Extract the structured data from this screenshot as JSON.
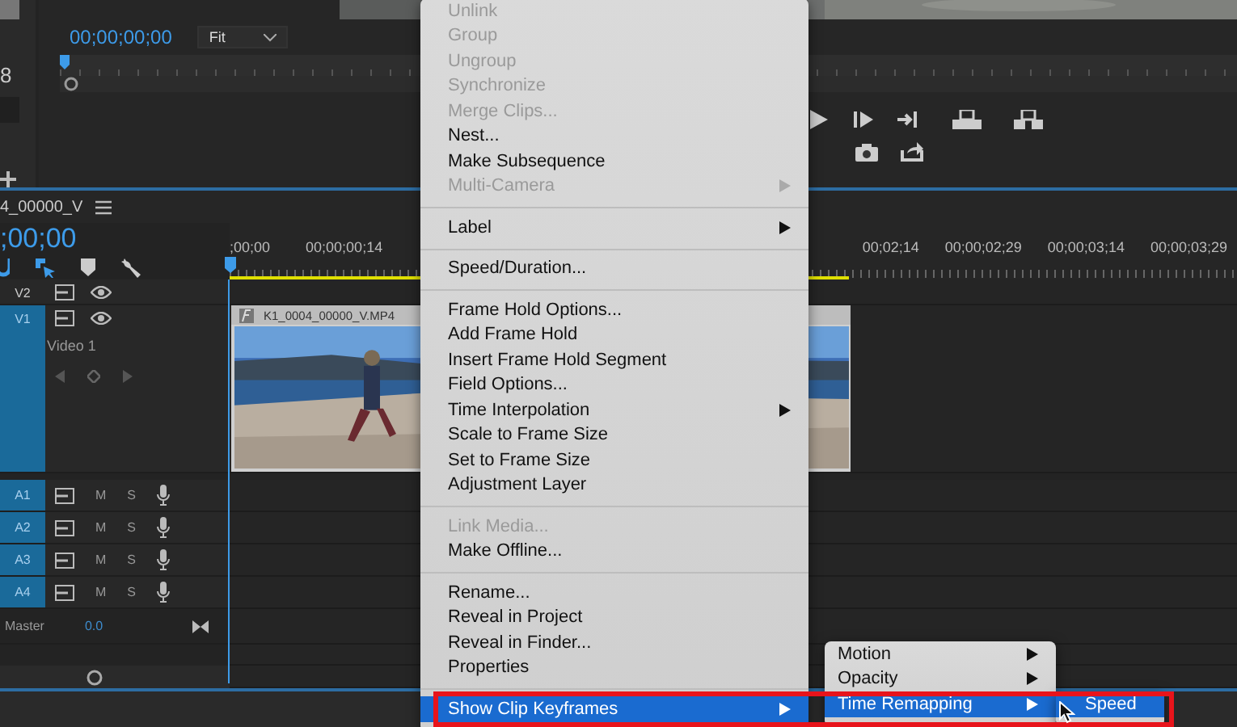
{
  "program_monitor": {
    "side_text": "8",
    "timecode": "00;00;00;00",
    "zoom": "Fit"
  },
  "sequence": {
    "tab_title": "4_00000_V",
    "timecode": ";00;00"
  },
  "ruler_left": [
    ";00;00",
    "00;00;00;14"
  ],
  "ruler_right": [
    "00;02;14",
    "00;00;02;29",
    "00;00;03;14",
    "00;00;03;29"
  ],
  "video_tracks": [
    {
      "name": "V2",
      "targeted": false
    },
    {
      "name": "V1",
      "label": "Video 1",
      "targeted": true
    }
  ],
  "audio_tracks": [
    {
      "name": "A1",
      "targeted": true,
      "mute": "M",
      "solo": "S"
    },
    {
      "name": "A2",
      "targeted": true,
      "mute": "M",
      "solo": "S"
    },
    {
      "name": "A3",
      "targeted": true,
      "mute": "M",
      "solo": "S"
    },
    {
      "name": "A4",
      "targeted": true,
      "mute": "M",
      "solo": "S"
    }
  ],
  "master": {
    "label": "Master",
    "value": "0.0"
  },
  "clip": {
    "name": "K1_0004_00000_V.MP4"
  },
  "context_menu": {
    "items": [
      {
        "kind": "item",
        "label": "Unlink",
        "disabled": true,
        "submenu": false,
        "selected": false
      },
      {
        "kind": "item",
        "label": "Group",
        "disabled": true,
        "submenu": false,
        "selected": false
      },
      {
        "kind": "item",
        "label": "Ungroup",
        "disabled": true,
        "submenu": false,
        "selected": false
      },
      {
        "kind": "item",
        "label": "Synchronize",
        "disabled": true,
        "submenu": false,
        "selected": false
      },
      {
        "kind": "item",
        "label": "Merge Clips...",
        "disabled": true,
        "submenu": false,
        "selected": false
      },
      {
        "kind": "item",
        "label": "Nest...",
        "disabled": false,
        "submenu": false,
        "selected": false
      },
      {
        "kind": "item",
        "label": "Make Subsequence",
        "disabled": false,
        "submenu": false,
        "selected": false
      },
      {
        "kind": "item",
        "label": "Multi-Camera",
        "disabled": true,
        "submenu": true,
        "selected": false
      },
      {
        "kind": "separator"
      },
      {
        "kind": "item",
        "label": "Label",
        "disabled": false,
        "submenu": true,
        "selected": false
      },
      {
        "kind": "separator"
      },
      {
        "kind": "item",
        "label": "Speed/Duration...",
        "disabled": false,
        "submenu": false,
        "selected": false
      },
      {
        "kind": "separator"
      },
      {
        "kind": "item",
        "label": "Frame Hold Options...",
        "disabled": false,
        "submenu": false,
        "selected": false
      },
      {
        "kind": "item",
        "label": "Add Frame Hold",
        "disabled": false,
        "submenu": false,
        "selected": false
      },
      {
        "kind": "item",
        "label": "Insert Frame Hold Segment",
        "disabled": false,
        "submenu": false,
        "selected": false
      },
      {
        "kind": "item",
        "label": "Field Options...",
        "disabled": false,
        "submenu": false,
        "selected": false
      },
      {
        "kind": "item",
        "label": "Time Interpolation",
        "disabled": false,
        "submenu": true,
        "selected": false
      },
      {
        "kind": "item",
        "label": "Scale to Frame Size",
        "disabled": false,
        "submenu": false,
        "selected": false
      },
      {
        "kind": "item",
        "label": "Set to Frame Size",
        "disabled": false,
        "submenu": false,
        "selected": false
      },
      {
        "kind": "item",
        "label": "Adjustment Layer",
        "disabled": false,
        "submenu": false,
        "selected": false
      },
      {
        "kind": "separator"
      },
      {
        "kind": "item",
        "label": "Link Media...",
        "disabled": true,
        "submenu": false,
        "selected": false
      },
      {
        "kind": "item",
        "label": "Make Offline...",
        "disabled": false,
        "submenu": false,
        "selected": false
      },
      {
        "kind": "separator"
      },
      {
        "kind": "item",
        "label": "Rename...",
        "disabled": false,
        "submenu": false,
        "selected": false
      },
      {
        "kind": "item",
        "label": "Reveal in Project",
        "disabled": false,
        "submenu": false,
        "selected": false
      },
      {
        "kind": "item",
        "label": "Reveal in Finder...",
        "disabled": false,
        "submenu": false,
        "selected": false
      },
      {
        "kind": "item",
        "label": "Properties",
        "disabled": false,
        "submenu": false,
        "selected": false
      },
      {
        "kind": "separator"
      },
      {
        "kind": "item",
        "label": "Show Clip Keyframes",
        "disabled": false,
        "submenu": true,
        "selected": true
      }
    ]
  },
  "keyframes_submenu": {
    "items": [
      {
        "kind": "item",
        "label": "Motion",
        "disabled": false,
        "submenu": true,
        "selected": false
      },
      {
        "kind": "item",
        "label": "Opacity",
        "disabled": false,
        "submenu": true,
        "selected": false
      },
      {
        "kind": "item",
        "label": "Time Remapping",
        "disabled": false,
        "submenu": true,
        "selected": true
      }
    ]
  },
  "time_remapping_submenu": {
    "items": [
      {
        "kind": "item",
        "label": "Speed",
        "disabled": false,
        "submenu": false,
        "selected": true
      }
    ]
  }
}
